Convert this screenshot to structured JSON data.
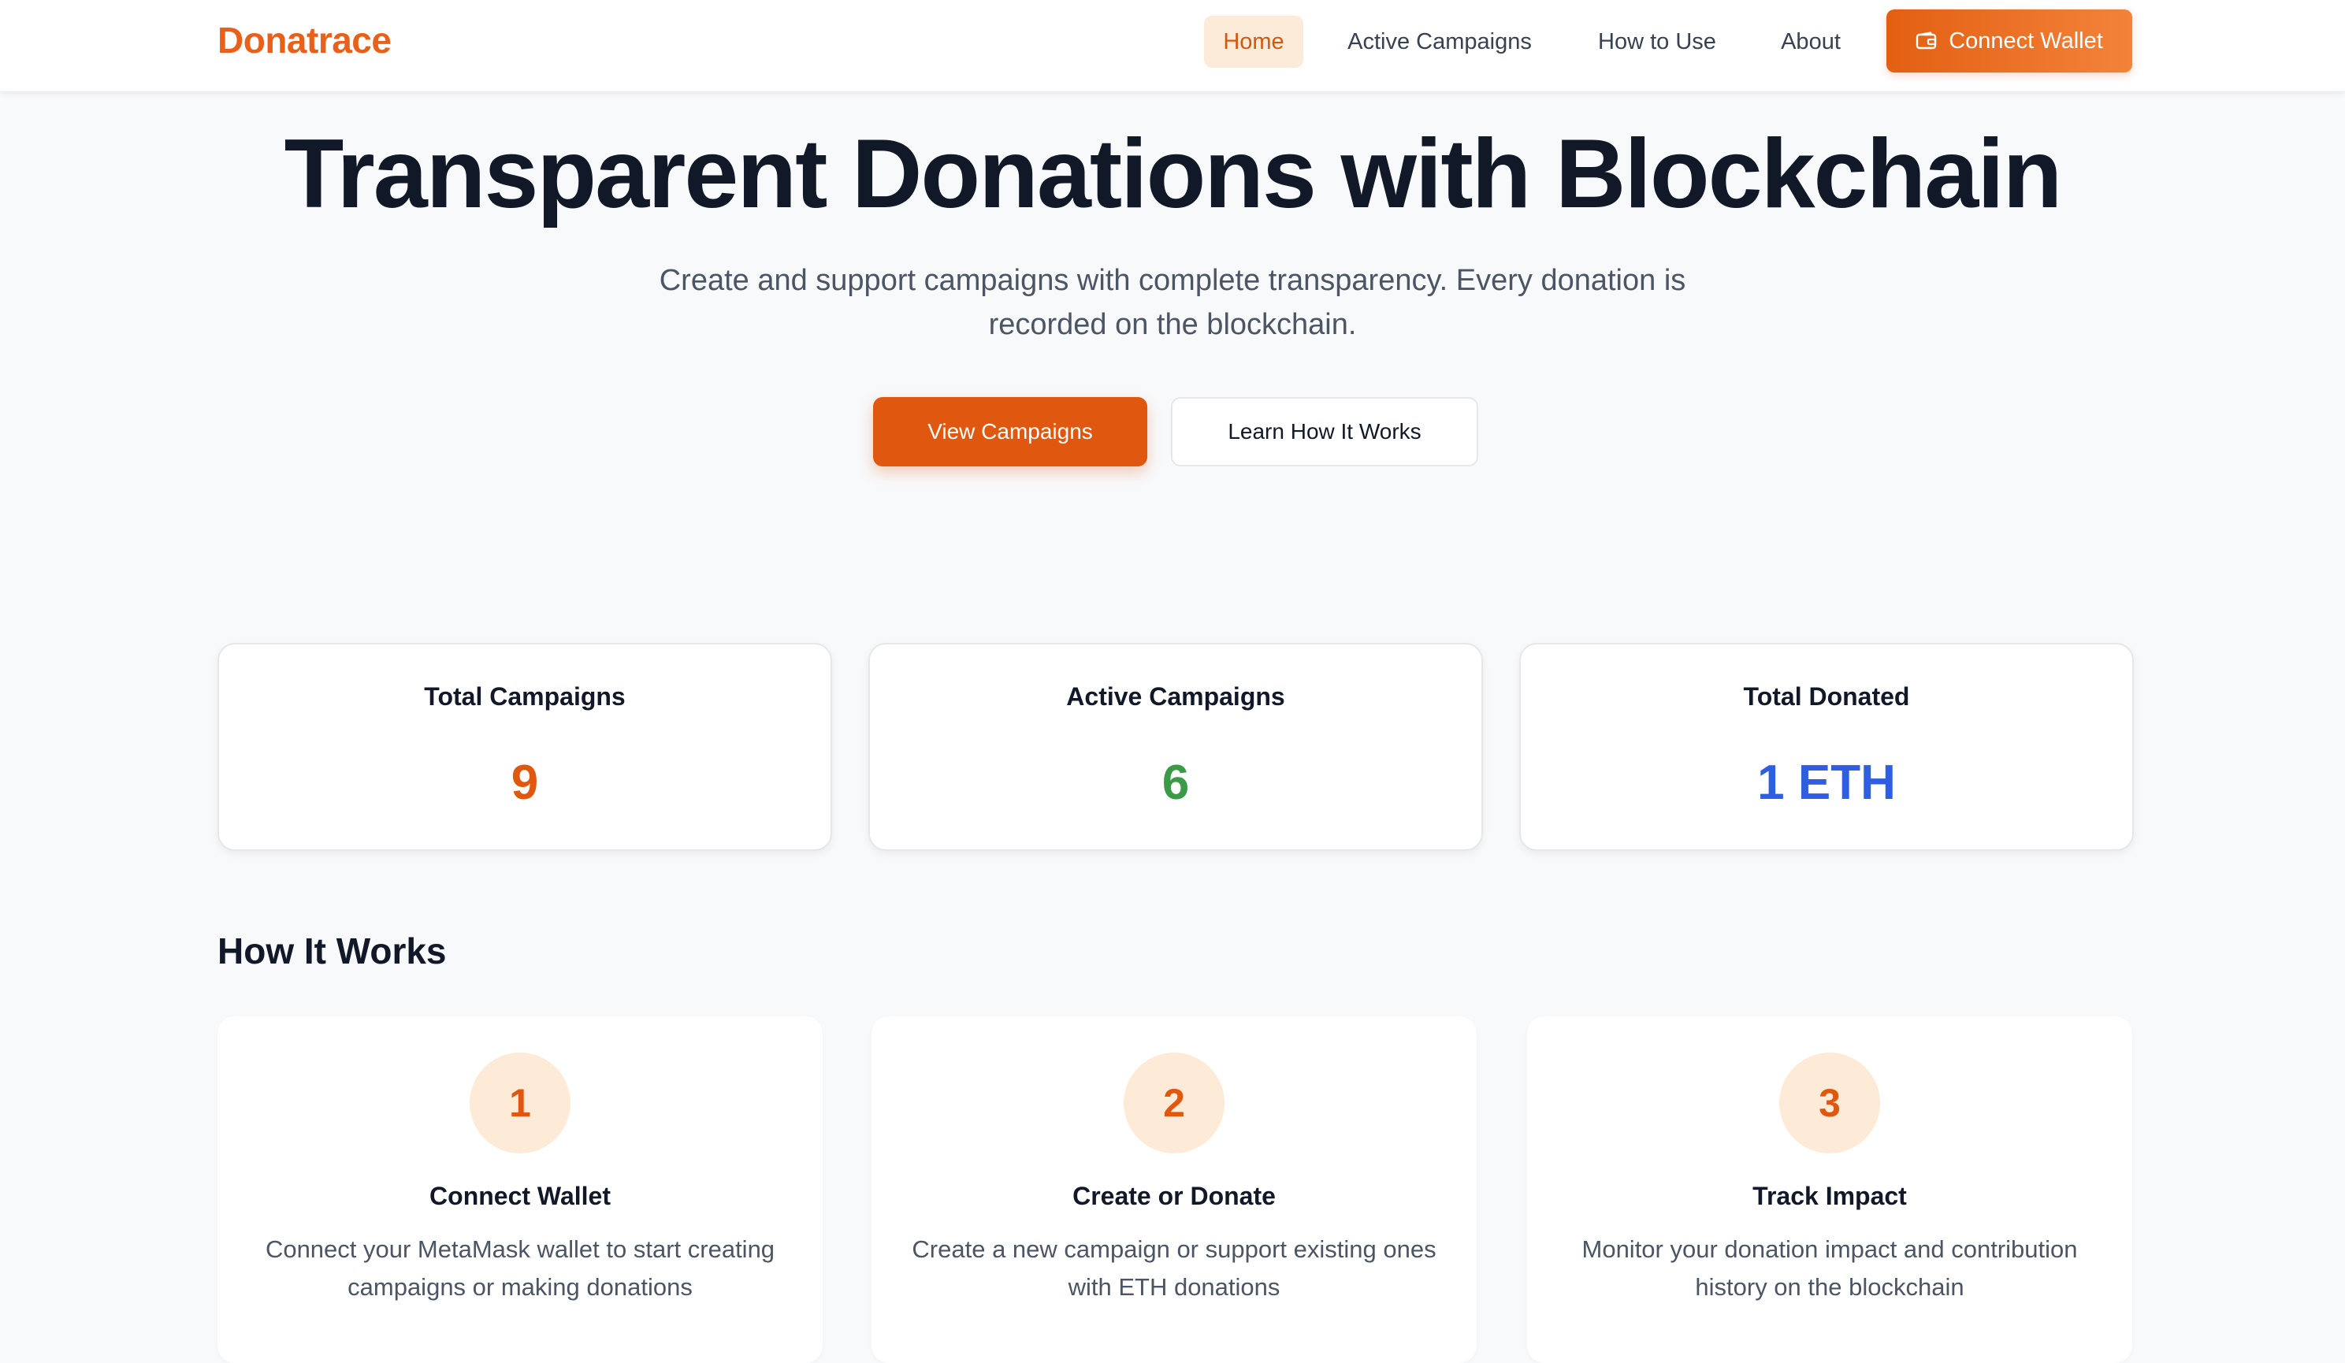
{
  "nav": {
    "logo": "Donatrace",
    "items": [
      {
        "label": "Home",
        "active": true
      },
      {
        "label": "Active Campaigns"
      },
      {
        "label": "How to Use"
      },
      {
        "label": "About"
      }
    ],
    "connect_label": "Connect Wallet",
    "connect_icon": "wallet-icon"
  },
  "hero": {
    "title": "Transparent Donations with Blockchain",
    "subtitle": "Create and support campaigns with complete transparency. Every donation is recorded on the blockchain.",
    "primary_label": "View Campaigns",
    "secondary_label": "Learn How It Works"
  },
  "stats": [
    {
      "label": "Total Campaigns",
      "value": "9",
      "color": "#e0580f"
    },
    {
      "label": "Active Campaigns",
      "value": "6",
      "color": "#3a9a46"
    },
    {
      "label": "Total Donated",
      "value": "1 ETH",
      "color": "#2f5fe0"
    }
  ],
  "how_it_works": {
    "title": "How It Works",
    "steps": [
      {
        "number": "1",
        "title": "Connect Wallet",
        "description": "Connect your MetaMask wallet to start creating campaigns or making donations"
      },
      {
        "number": "2",
        "title": "Create or Donate",
        "description": "Create a new campaign or support existing ones with ETH donations"
      },
      {
        "number": "3",
        "title": "Track Impact",
        "description": "Monitor your donation impact and contribution history on the blockchain"
      }
    ]
  },
  "colors": {
    "accent": "#e0580f",
    "accent_light": "#fdebd9",
    "green": "#3a9a46",
    "blue": "#2f5fe0"
  }
}
